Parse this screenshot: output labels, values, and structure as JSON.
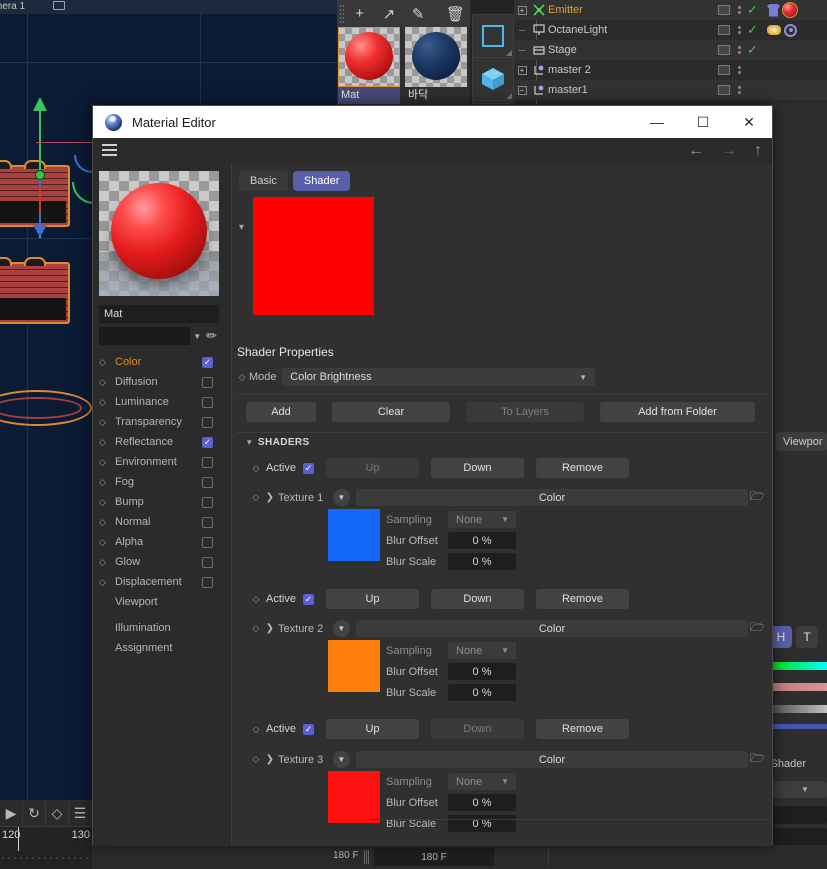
{
  "viewport": {
    "camera_label": "mera 1",
    "bg_color": "#0b1b33"
  },
  "material_manager": {
    "tools": [
      "plus-icon",
      "arrow-icon",
      "eyedropper-icon",
      "trash-icon"
    ],
    "materials": [
      {
        "name": "Mat",
        "selected": true,
        "color": "#e51b1b"
      },
      {
        "name": "바닥",
        "selected": false,
        "color": "#1e3b66"
      }
    ]
  },
  "toolbar": {
    "items": [
      "square-icon",
      "cube-icon",
      "text-icon"
    ]
  },
  "object_manager": {
    "rows": [
      {
        "name": "Emitter",
        "icon": "emitter-icon",
        "highlight": true,
        "expand": "+",
        "visible": true,
        "tags": [
          "shirt-tag",
          "material-tag"
        ]
      },
      {
        "name": "OctaneLight",
        "icon": "light-icon",
        "highlight": false,
        "expand": "-",
        "visible": true,
        "tags": [
          "light-tag",
          "octane-tag"
        ]
      },
      {
        "name": "Stage",
        "icon": "stage-icon",
        "highlight": false,
        "expand": "-",
        "visible": true,
        "tags": []
      },
      {
        "name": "master 2",
        "icon": "null-icon",
        "highlight": false,
        "expand": "+",
        "visible": false,
        "tags": []
      },
      {
        "name": "master1",
        "icon": "null-icon",
        "highlight": false,
        "expand": "-",
        "visible": false,
        "tags": []
      }
    ]
  },
  "right_dock": {
    "viewport_button": "Viewpor",
    "h_button": "H",
    "t_button": "T",
    "shader_label": "ti Shader",
    "percent_1": "%",
    "percent_2": "%",
    "gradients": [
      "#00ff00,#00ffff",
      "#c98080,#d08a8a",
      "#555555,#b8b8b8",
      "#3a4fa0,#4a5fb0"
    ]
  },
  "timeline": {
    "icons": [
      "play-icon",
      "loop-icon",
      "key-icon",
      "layers-icon"
    ],
    "frame_start": "120",
    "frame_end": "130"
  },
  "bottom_strip": {
    "field_left": "180 F",
    "field_right": "180 F"
  },
  "material_editor": {
    "title": "Material Editor",
    "window_buttons": {
      "minimize": "—",
      "maximize": "☐",
      "close": "✕"
    },
    "nav": {
      "back": "←",
      "forward": "→",
      "up": "↑"
    },
    "preview_name": "Mat",
    "channels": [
      {
        "label": "Color",
        "checked": true,
        "active": true
      },
      {
        "label": "Diffusion",
        "checked": false,
        "active": false
      },
      {
        "label": "Luminance",
        "checked": false,
        "active": false
      },
      {
        "label": "Transparency",
        "checked": false,
        "active": false
      },
      {
        "label": "Reflectance",
        "checked": true,
        "active": false
      },
      {
        "label": "Environment",
        "checked": false,
        "active": false
      },
      {
        "label": "Fog",
        "checked": false,
        "active": false
      },
      {
        "label": "Bump",
        "checked": false,
        "active": false
      },
      {
        "label": "Normal",
        "checked": false,
        "active": false
      },
      {
        "label": "Alpha",
        "checked": false,
        "active": false
      },
      {
        "label": "Glow",
        "checked": false,
        "active": false
      },
      {
        "label": "Displacement",
        "checked": false,
        "active": false
      }
    ],
    "plain_items": [
      "Viewport",
      "Illumination",
      "Assignment"
    ],
    "tabs": [
      {
        "label": "Basic",
        "active": false
      },
      {
        "label": "Shader",
        "active": true
      }
    ],
    "big_swatch_color": "#ff0000",
    "section_title": "Shader Properties",
    "mode": {
      "label": "Mode",
      "value": "Color Brightness"
    },
    "action_buttons": [
      {
        "label": "Add",
        "enabled": true
      },
      {
        "label": "Clear",
        "enabled": true
      },
      {
        "label": "To Layers",
        "enabled": false
      },
      {
        "label": "Add from Folder",
        "enabled": true
      }
    ],
    "shaders_header": "SHADERS",
    "shader_entries": [
      {
        "active_label": "Active",
        "active_checked": true,
        "up": {
          "label": "Up",
          "enabled": false
        },
        "down": {
          "label": "Down",
          "enabled": true
        },
        "remove": {
          "label": "Remove",
          "enabled": true
        },
        "texture_name": "Texture 1",
        "texture_value": "Color",
        "swatch_color": "#1569fa",
        "sampling_label": "Sampling",
        "sampling_value": "None",
        "blur_offset_label": "Blur Offset",
        "blur_offset_value": "0 %",
        "blur_scale_label": "Blur Scale",
        "blur_scale_value": "0 %"
      },
      {
        "active_label": "Active",
        "active_checked": true,
        "up": {
          "label": "Up",
          "enabled": true
        },
        "down": {
          "label": "Down",
          "enabled": true
        },
        "remove": {
          "label": "Remove",
          "enabled": true
        },
        "texture_name": "Texture 2",
        "texture_value": "Color",
        "swatch_color": "#ff7f0a",
        "sampling_label": "Sampling",
        "sampling_value": "None",
        "blur_offset_label": "Blur Offset",
        "blur_offset_value": "0 %",
        "blur_scale_label": "Blur Scale",
        "blur_scale_value": "0 %"
      },
      {
        "active_label": "Active",
        "active_checked": true,
        "up": {
          "label": "Up",
          "enabled": true
        },
        "down": {
          "label": "Down",
          "enabled": false
        },
        "remove": {
          "label": "Remove",
          "enabled": true
        },
        "texture_name": "Texture 3",
        "texture_value": "Color",
        "swatch_color": "#ff1010",
        "sampling_label": "Sampling",
        "sampling_value": "None",
        "blur_offset_label": "Blur Offset",
        "blur_offset_value": "0 %",
        "blur_scale_label": "Blur Scale",
        "blur_scale_value": "0 %"
      }
    ]
  }
}
